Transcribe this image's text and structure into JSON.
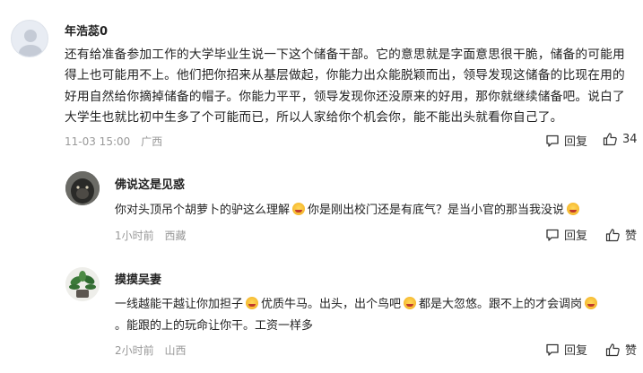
{
  "comments": [
    {
      "username": "年浩蕊0",
      "text_lines": [
        "还有给准备参加工作的大学毕业生说一下这个储备干部。它的意思就是字面意思很干脆，储备的可能用",
        "得上也可能用不上。他们把你招来从基层做起，你能力出众能脱颖而出，领导发现这储备的比现在用的",
        "好用自然给你摘掉储备的帽子。你能力平平，领导发现你还没原来的好用，那你就继续储备吧。说白了",
        "大学生也就比初中生多了个可能而已，所以人家给你个机会你，能不能出头就看你自己了。"
      ],
      "time": "11-03 15:00",
      "location": "广西",
      "reply_label": "回复",
      "like_count": "34"
    },
    {
      "username": "佛说这是见惑",
      "text_part1": "你对头顶吊个胡萝卜的驴这么理解",
      "text_part2": "你是刚出校门还是有底气？是当小官的那当我没说",
      "time": "1小时前",
      "location": "西藏",
      "reply_label": "回复",
      "like_label": "赞"
    },
    {
      "username": "摸摸吴妻",
      "line1_a": "一线越能干越让你加担子",
      "line1_b": "优质牛马。出头，出个鸟吧",
      "line1_c": "都是大忽悠。跟不上的才会调岗",
      "line2": "。能跟的上的玩命让你干。工资一样多",
      "time": "2小时前",
      "location": "山西",
      "reply_label": "回复",
      "like_label": "赞"
    }
  ],
  "icons": {
    "reply": "comment-bubble-icon",
    "like": "thumbs-up-icon",
    "emoji": "laughing-emoji-icon"
  },
  "colors": {
    "meta_text": "#999999",
    "main_text": "#222222"
  }
}
